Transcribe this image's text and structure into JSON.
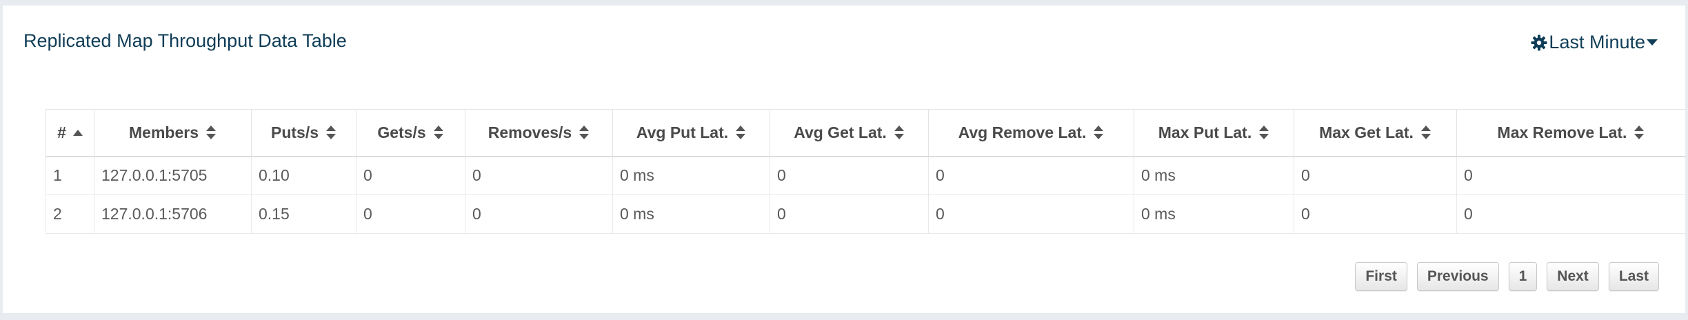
{
  "panel": {
    "title": "Replicated Map Throughput Data Table",
    "range_label": "Last Minute"
  },
  "table": {
    "columns": [
      "#",
      "Members",
      "Puts/s",
      "Gets/s",
      "Removes/s",
      "Avg Put Lat.",
      "Avg Get Lat.",
      "Avg Remove Lat.",
      "Max Put Lat.",
      "Max Get Lat.",
      "Max Remove Lat."
    ],
    "rows": [
      [
        "1",
        "127.0.0.1:5705",
        "0.10",
        "0",
        "0",
        "0 ms",
        "0",
        "0",
        "0 ms",
        "0",
        "0"
      ],
      [
        "2",
        "127.0.0.1:5706",
        "0.15",
        "0",
        "0",
        "0 ms",
        "0",
        "0",
        "0 ms",
        "0",
        "0"
      ]
    ]
  },
  "pagination": {
    "first": "First",
    "previous": "Previous",
    "page": "1",
    "next": "Next",
    "last": "Last"
  },
  "icons": {
    "range": "gear-icon",
    "range_caret": "caret-down-icon",
    "sort": "sort-icon",
    "sort_asc": "sort-asc-icon"
  },
  "colors": {
    "title": "#0f3d57",
    "background": "#e8ebef"
  }
}
